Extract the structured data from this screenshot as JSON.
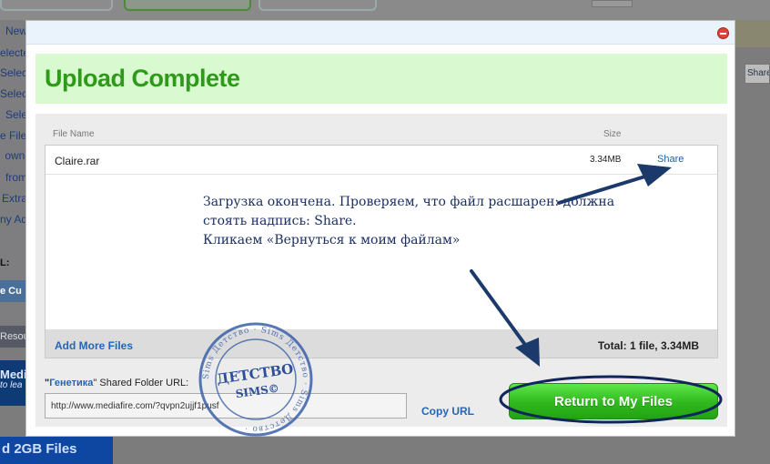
{
  "background": {
    "left_items": [
      "New",
      "elected",
      "Selec",
      "Selec",
      "Sele",
      "e Files",
      "ownl",
      "from",
      "Extra",
      "ny Ad"
    ],
    "left_label": "L:",
    "left_button": "e Cu",
    "resources": "Resou",
    "brand": "MediaF",
    "brand_sub": "to lea",
    "share": "Share",
    "banner": "d 2GB Files"
  },
  "modal": {
    "title": "Upload Complete",
    "columns": {
      "name": "File Name",
      "size": "Size"
    },
    "files": [
      {
        "name": "Claire.rar",
        "size": "3.34MB",
        "action": "Share"
      }
    ],
    "add_more": "Add More Files",
    "total": "Total: 1 file, 3.34MB",
    "folder_prefix": "\"",
    "folder_name": "Генетика",
    "folder_suffix": "\" Shared Folder URL:",
    "url_value": "http://www.mediafire.com/?qvpn2ujjf1pusf",
    "copy_url": "Copy URL",
    "return_button": "Return to My Files"
  },
  "annotation": {
    "lines": [
      "Загрузка окончена. Проверяем, что файл расшарен: должна",
      "стоять надпись: Share.",
      "Кликаем «Вернуться к моим файлам»"
    ]
  },
  "stamp": {
    "main": "ДЕТСТВО",
    "sub": "SIMS©",
    "ring": "Sims Детство · Sims Детство · Sims Детство ·"
  },
  "colors": {
    "title_green": "#2e9a19",
    "link_blue": "#2466b6",
    "arrow_navy": "#1b3a6b",
    "stamp_blue": "#3a5fa8"
  }
}
